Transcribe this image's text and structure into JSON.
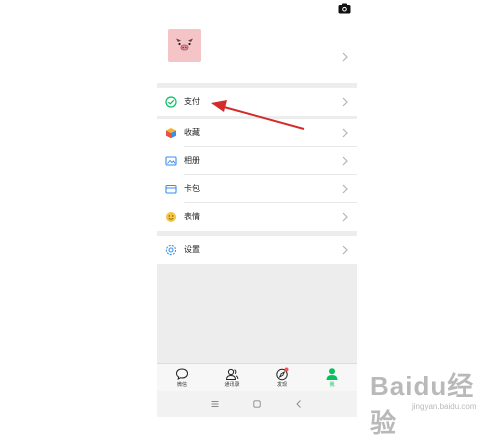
{
  "menu": {
    "pay": {
      "label": "支付"
    },
    "favorites": {
      "label": "收藏"
    },
    "album": {
      "label": "相册"
    },
    "cards": {
      "label": "卡包"
    },
    "stickers": {
      "label": "表情"
    },
    "settings": {
      "label": "设置"
    }
  },
  "tabs": {
    "chats": {
      "label": "微信"
    },
    "contacts": {
      "label": "通讯录"
    },
    "discover": {
      "label": "发现"
    },
    "me": {
      "label": "我"
    }
  },
  "colors": {
    "accent": "#07c160",
    "arrow": "#d42a2a",
    "badge": "#fa5151"
  },
  "watermark": {
    "brand": "Baidu经验",
    "url": "jingyan.baidu.com"
  }
}
